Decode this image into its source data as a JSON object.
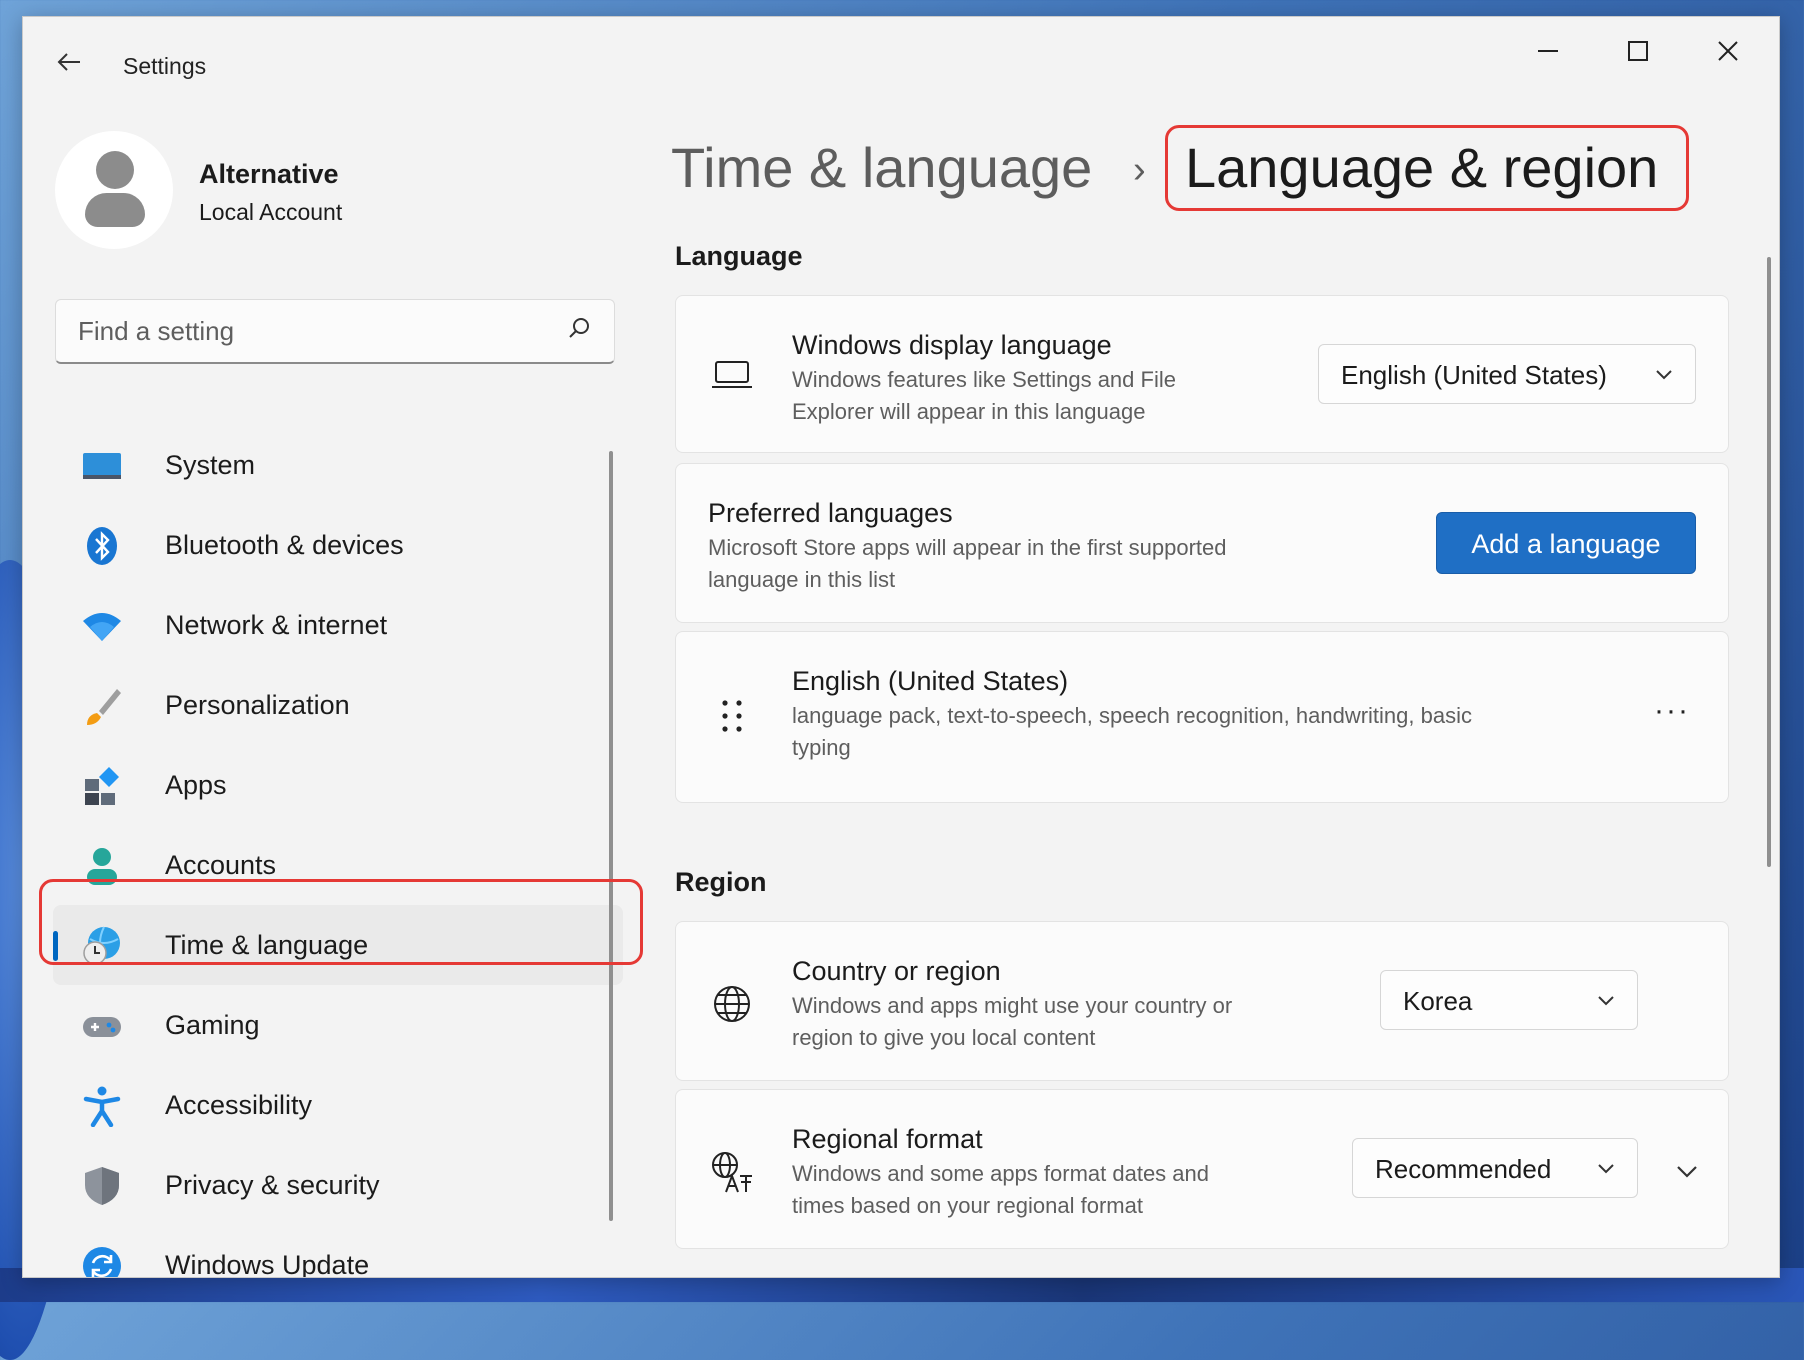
{
  "window": {
    "app_title": "Settings",
    "controls": {
      "minimize": "—",
      "maximize": "☐",
      "close": "✕"
    }
  },
  "profile": {
    "name": "Alternative",
    "account_type": "Local Account"
  },
  "search": {
    "placeholder": "Find a setting"
  },
  "sidebar": {
    "items": [
      {
        "label": "System",
        "icon": "monitor-icon"
      },
      {
        "label": "Bluetooth & devices",
        "icon": "bluetooth-icon"
      },
      {
        "label": "Network & internet",
        "icon": "wifi-icon"
      },
      {
        "label": "Personalization",
        "icon": "brush-icon"
      },
      {
        "label": "Apps",
        "icon": "apps-icon"
      },
      {
        "label": "Accounts",
        "icon": "person-icon"
      },
      {
        "label": "Time & language",
        "icon": "globe-clock-icon",
        "active": true
      },
      {
        "label": "Gaming",
        "icon": "gamepad-icon"
      },
      {
        "label": "Accessibility",
        "icon": "accessibility-icon"
      },
      {
        "label": "Privacy & security",
        "icon": "shield-icon"
      },
      {
        "label": "Windows Update",
        "icon": "update-icon"
      }
    ]
  },
  "breadcrumb": {
    "parent": "Time & language",
    "separator": "›",
    "current": "Language & region"
  },
  "language_section": {
    "title": "Language",
    "display_language": {
      "title": "Windows display language",
      "desc_line1": "Windows features like Settings and File",
      "desc_line2": "Explorer will appear in this language",
      "value": "English (United States)"
    },
    "preferred": {
      "title": "Preferred languages",
      "desc_line1": "Microsoft Store apps will appear in the first supported",
      "desc_line2": "language in this list",
      "button": "Add a language"
    },
    "installed": {
      "title": "English (United States)",
      "desc_line1": "language pack, text-to-speech, speech recognition, handwriting, basic",
      "desc_line2": "typing",
      "more": "···"
    }
  },
  "region_section": {
    "title": "Region",
    "country": {
      "title": "Country or region",
      "desc_line1": "Windows and apps might use your country or",
      "desc_line2": "region to give you local content",
      "value": "Korea"
    },
    "format": {
      "title": "Regional format",
      "desc_line1": "Windows and some apps format dates and",
      "desc_line2": "times based on your regional format",
      "value": "Recommended"
    }
  },
  "colors": {
    "accent": "#1f6fc5",
    "highlight": "#e53935",
    "active_indicator": "#0067c0"
  }
}
